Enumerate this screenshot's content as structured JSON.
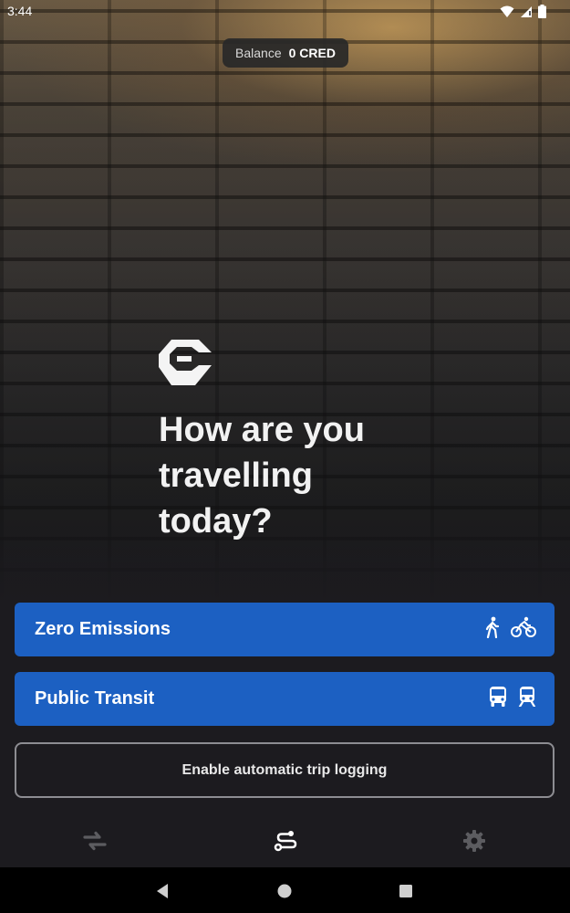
{
  "status_bar": {
    "time": "3:44",
    "icons": [
      "wifi-icon",
      "signal-icon",
      "battery-icon"
    ]
  },
  "balance": {
    "label": "Balance",
    "value": "0 CRED"
  },
  "brand": {
    "logo": "app-logo",
    "heading": "How are you travelling today?"
  },
  "options": [
    {
      "label": "Zero Emissions",
      "icons": [
        "walk-icon",
        "bike-icon"
      ]
    },
    {
      "label": "Public Transit",
      "icons": [
        "bus-icon",
        "train-icon"
      ]
    }
  ],
  "auto_logging": {
    "label": "Enable automatic trip logging"
  },
  "bottom_nav": {
    "items": [
      "swap-icon",
      "route-icon",
      "gear-icon"
    ]
  },
  "system_nav": {
    "items": [
      "back-icon",
      "home-icon",
      "recents-icon"
    ]
  },
  "colors": {
    "primary_button": "#1c60c2",
    "background": "#1c1b1f",
    "outline": "#8d8d92"
  }
}
